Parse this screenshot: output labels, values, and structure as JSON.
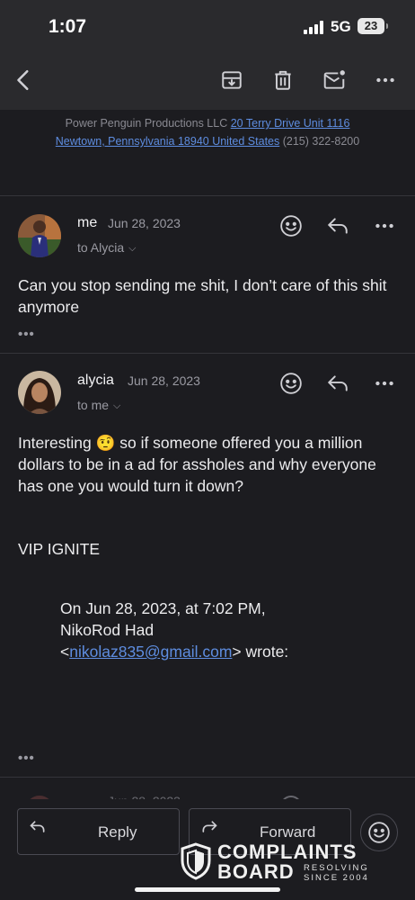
{
  "status_bar": {
    "time": "1:07",
    "network": "5G",
    "battery": "23"
  },
  "toolbar": {
    "back_icon": "chevron-left-icon",
    "archive_icon": "archive-box-icon",
    "trash_icon": "trash-icon",
    "mark_icon": "envelope-badge-icon",
    "more_icon": "ellipsis-icon"
  },
  "letterhead": {
    "company": "Power Penguin Productions LLC",
    "address_line1": "20 Terry Drive Unit 1116",
    "address_line2": "Newtown, Pennsylvania 18940 United States",
    "phone": "(215) 322-8200"
  },
  "messages": [
    {
      "sender": "me",
      "date": "Jun 28, 2023",
      "recipient": "to Alycia",
      "body": "Can you stop sending me shit, I don’t care of this shit anymore",
      "more": "•••"
    },
    {
      "sender": "alycia",
      "date": "Jun 28, 2023",
      "recipient": "to me",
      "body": "Interesting 🤨 so if someone offered you a million dollars to be in a ad for assholes and why everyone has one you would turn it down?",
      "signature": "VIP IGNITE",
      "quote_line1": "On Jun 28, 2023, at 7:02 PM,",
      "quote_line2": "NikoRod Had",
      "quote_email": "nikolaz835@gmail.com",
      "quote_wrote": "wrote:",
      "more": "•••"
    }
  ],
  "peek": {
    "date": "Jun 28, 2023"
  },
  "bottom_bar": {
    "reply_label": "Reply",
    "forward_label": "Forward"
  },
  "watermark": {
    "line1": "COMPLAINTS",
    "line2": "BOARD",
    "tag1": "RESOLVING",
    "tag2": "SINCE 2004"
  }
}
